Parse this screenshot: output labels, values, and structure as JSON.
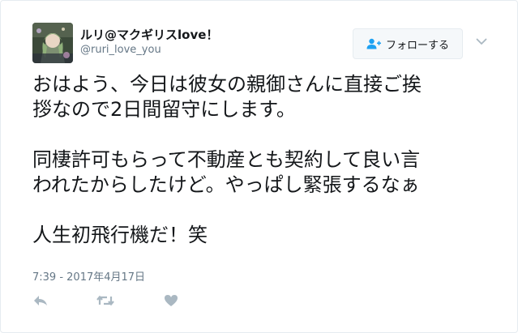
{
  "user": {
    "display_name": "ルリ@マクギリスlove！",
    "username": "@ruri_love_you"
  },
  "follow_button": {
    "label": "フォローする",
    "icon": "add-user-icon"
  },
  "tweet": {
    "text": "おはよう、今日は彼女の親御さんに直接ご挨\n拶なので2日間留守にします。\n\n同棲許可もらって不動産とも契約して良い言\nわれたからしたけど。やっぱし緊張するなぁ\n\n人生初飛行機だ！笑",
    "timestamp": "7:39 - 2017年4月17日"
  },
  "actions": {
    "reply_icon": "reply-icon",
    "retweet_icon": "retweet-icon",
    "like_icon": "heart-icon"
  },
  "colors": {
    "text": "#14171a",
    "secondary": "#657786",
    "icon": "#aab8c2",
    "border": "#e6ecf0",
    "button_bg": "#f5f8fa"
  }
}
